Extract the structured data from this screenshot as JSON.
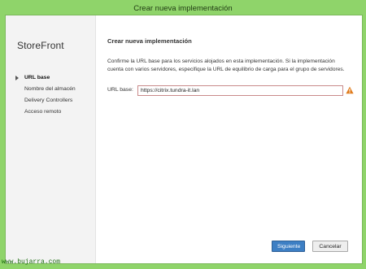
{
  "window": {
    "title": "Crear nueva implementación"
  },
  "sidebar": {
    "brand": "StoreFront",
    "items": [
      {
        "label": "URL base",
        "active": true
      },
      {
        "label": "Nombre del almacén",
        "active": false
      },
      {
        "label": "Delivery Controllers",
        "active": false
      },
      {
        "label": "Acceso remoto",
        "active": false
      }
    ]
  },
  "main": {
    "heading": "Crear nueva implementación",
    "description": "Confirme la URL base para los servicios alojados en esta implementación. Si la implementación cuenta con varios servidores, especifique la URL de equilibrio de carga para el grupo de servidores.",
    "url_label": "URL base:",
    "url_value": "https://citrix.tundra-it.lan",
    "warning_icon": "warning-icon"
  },
  "buttons": {
    "next": "Siguiente",
    "cancel": "Cancelar"
  },
  "watermark": "www.bujarra.com",
  "colors": {
    "titlebar": "#8fd46a",
    "primary_button": "#3d7fc4",
    "warning": "#e07b1c"
  }
}
